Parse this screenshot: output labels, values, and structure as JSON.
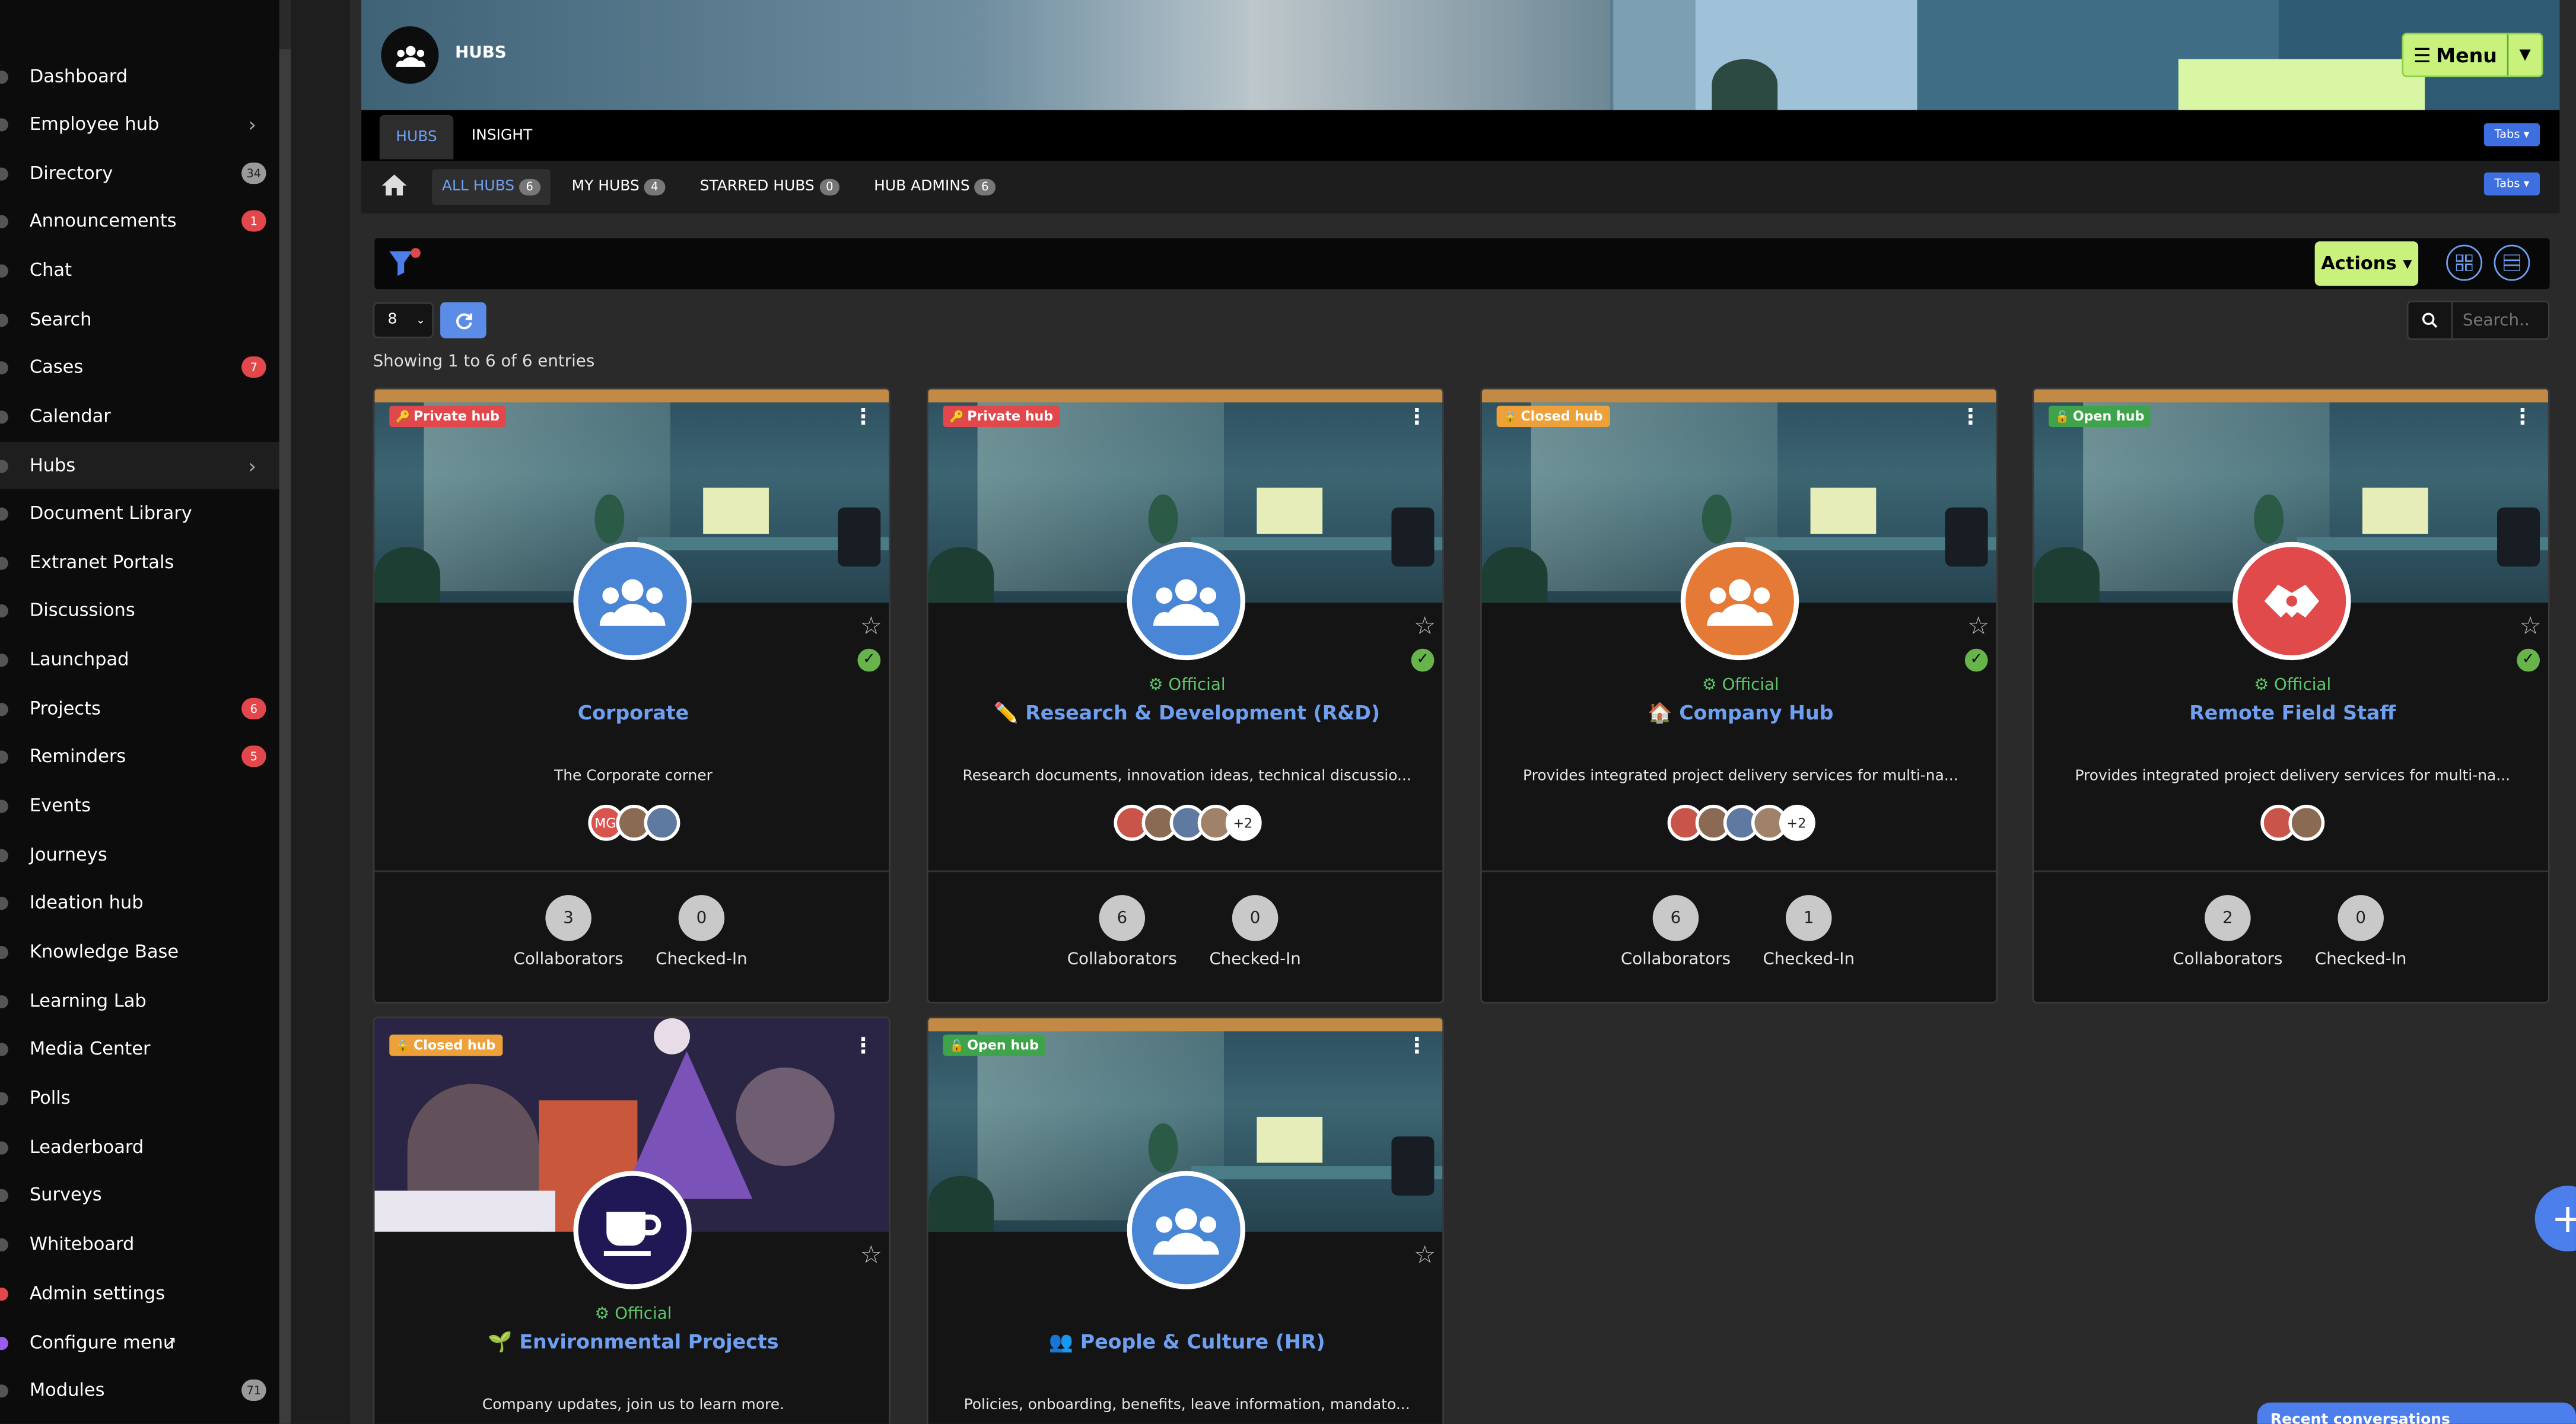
{
  "sidebar": {
    "items": [
      {
        "label": "Dashboard",
        "badge": "",
        "chevron": false
      },
      {
        "label": "Employee hub",
        "badge": "",
        "chevron": true
      },
      {
        "label": "Directory",
        "badge": "34",
        "badge_color": "gray"
      },
      {
        "label": "Announcements",
        "badge": "1",
        "badge_color": "red"
      },
      {
        "label": "Chat",
        "badge": ""
      },
      {
        "label": "Search",
        "badge": ""
      },
      {
        "label": "Cases",
        "badge": "7",
        "badge_color": "red"
      },
      {
        "label": "Calendar",
        "badge": ""
      },
      {
        "label": "Hubs",
        "badge": "",
        "chevron": true,
        "active": true
      },
      {
        "label": "Document Library",
        "badge": ""
      },
      {
        "label": "Extranet Portals",
        "badge": ""
      },
      {
        "label": "Discussions",
        "badge": ""
      },
      {
        "label": "Launchpad",
        "badge": ""
      },
      {
        "label": "Projects",
        "badge": "6",
        "badge_color": "red"
      },
      {
        "label": "Reminders",
        "badge": "5",
        "badge_color": "red"
      },
      {
        "label": "Events",
        "badge": ""
      },
      {
        "label": "Journeys",
        "badge": ""
      },
      {
        "label": "Ideation hub",
        "badge": ""
      },
      {
        "label": "Knowledge Base",
        "badge": ""
      },
      {
        "label": "Learning Lab",
        "badge": ""
      },
      {
        "label": "Media Center",
        "badge": ""
      },
      {
        "label": "Polls",
        "badge": ""
      },
      {
        "label": "Leaderboard",
        "badge": ""
      },
      {
        "label": "Surveys",
        "badge": ""
      },
      {
        "label": "Whiteboard",
        "badge": ""
      },
      {
        "label": "Admin settings",
        "badge": ""
      },
      {
        "label": "Configure menu",
        "badge": ""
      },
      {
        "label": "Modules",
        "badge": "71",
        "badge_color": "gray"
      }
    ]
  },
  "header": {
    "title": "HUBS",
    "menu_label": "Menu",
    "icon": "users-icon"
  },
  "tabs": {
    "items": [
      "HUBS",
      "INSIGHT"
    ],
    "tabs_button": "Tabs"
  },
  "subtabs": {
    "items": [
      {
        "label": "ALL HUBS",
        "count": "6"
      },
      {
        "label": "MY HUBS",
        "count": "4"
      },
      {
        "label": "STARRED HUBS",
        "count": "0"
      },
      {
        "label": "HUB ADMINS",
        "count": "6"
      }
    ],
    "tabs_button": "Tabs"
  },
  "toolbar": {
    "actions_label": "Actions",
    "page_size": "8",
    "showing_text": "Showing 1 to 6 of 6 entries",
    "search_placeholder": "Search.."
  },
  "hubs": [
    {
      "badge": "Private hub",
      "badge_type": "private",
      "official": "",
      "title": "Corporate",
      "title_emoji": "",
      "desc": "The Corporate corner",
      "collaborators": "3",
      "checked_in": "0",
      "avatar_color": "#4a86d6",
      "avatar_icon": "users-icon",
      "members": [
        "MG",
        "",
        ""
      ]
    },
    {
      "badge": "Private hub",
      "badge_type": "private",
      "official": "Official",
      "title": "Research & Development (R&D)",
      "title_emoji": "✏️",
      "desc": "Research documents, innovation ideas, technical discussio...",
      "collaborators": "6",
      "checked_in": "0",
      "avatar_color": "#4a86d6",
      "avatar_icon": "users-icon",
      "members": [
        "",
        "",
        "",
        "",
        "+2"
      ]
    },
    {
      "badge": "Closed hub",
      "badge_type": "closed",
      "official": "Official",
      "title": "Company Hub",
      "title_emoji": "🏠",
      "desc": "Provides integrated project delivery services for multi-na...",
      "collaborators": "6",
      "checked_in": "1",
      "avatar_color": "#e57a37",
      "avatar_icon": "users-icon",
      "members": [
        "",
        "",
        "",
        "",
        "+2"
      ]
    },
    {
      "badge": "Open hub",
      "badge_type": "open",
      "official": "Official",
      "title": "Remote Field Staff",
      "title_emoji": "",
      "desc": "Provides integrated project delivery services for multi-na...",
      "collaborators": "2",
      "checked_in": "0",
      "avatar_color": "#e04a4a",
      "avatar_icon": "handshake-icon",
      "members": [
        "",
        ""
      ]
    },
    {
      "badge": "Closed hub",
      "badge_type": "closed",
      "official": "Official",
      "title": "Environmental Projects",
      "title_emoji": "🌱",
      "desc": "Company updates, join us to learn more.",
      "avatar_color": "#1f1854",
      "avatar_icon": "coffee-icon"
    },
    {
      "badge": "Open hub",
      "badge_type": "open",
      "official": "",
      "title": "People & Culture (HR)",
      "title_emoji": "👥",
      "desc": "Policies, onboarding, benefits, leave information, mandato...",
      "avatar_color": "#4a86d6",
      "avatar_icon": "users-icon"
    }
  ],
  "stats_labels": {
    "collaborators": "Collaborators",
    "checked_in": "Checked-In"
  },
  "recent_conversations": "Recent conversations"
}
